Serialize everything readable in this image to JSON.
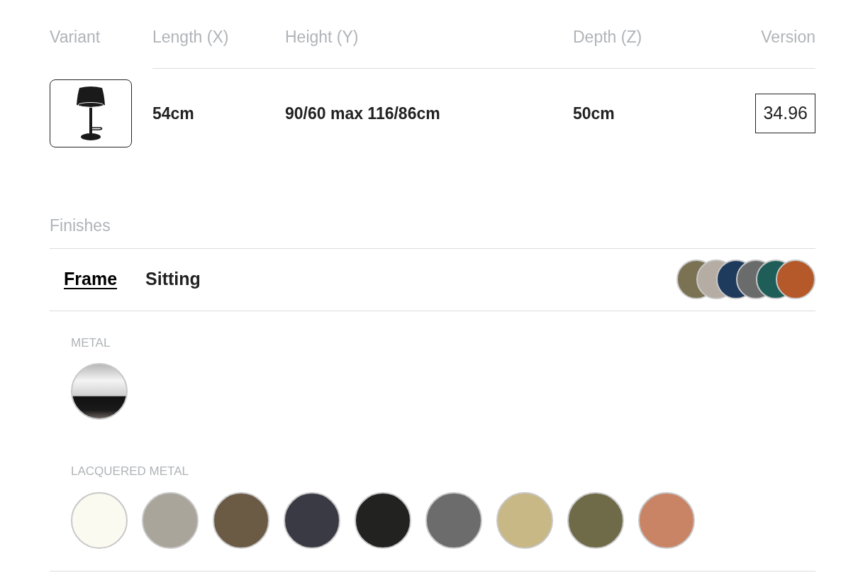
{
  "table": {
    "columns": [
      "Variant",
      "Length (X)",
      "Height (Y)",
      "Depth (Z)",
      "Version"
    ],
    "rows": [
      {
        "length": "54cm",
        "height": "90/60 max 116/86cm",
        "depth": "50cm",
        "version": "34.96"
      }
    ]
  },
  "finishes": {
    "title": "Finishes",
    "tabs": [
      {
        "label": "Frame",
        "selected": true
      },
      {
        "label": "Sitting",
        "selected": false
      }
    ],
    "preview_swatches": [
      {
        "color": "#7b7254"
      },
      {
        "color": "#b5ada4"
      },
      {
        "color": "#1e3a5c"
      },
      {
        "color": "#6a6b6b"
      },
      {
        "color": "#1f5e58"
      },
      {
        "color": "#b5582a"
      }
    ],
    "groups": [
      {
        "title": "METAL",
        "swatches": [
          {
            "kind": "chrome"
          }
        ]
      },
      {
        "title": "LACQUERED METAL",
        "swatches": [
          {
            "kind": "plain",
            "color": "#fbfaf0"
          },
          {
            "kind": "plain",
            "color": "#aaa59a"
          },
          {
            "kind": "plain",
            "color": "#6b5a44"
          },
          {
            "kind": "plain",
            "color": "#393a44"
          },
          {
            "kind": "plain",
            "color": "#222220"
          },
          {
            "kind": "plain",
            "color": "#6c6c6c"
          },
          {
            "kind": "plain",
            "color": "#c8b886"
          },
          {
            "kind": "plain",
            "color": "#6f6a48"
          },
          {
            "kind": "plain",
            "color": "#c98466"
          }
        ]
      }
    ]
  }
}
